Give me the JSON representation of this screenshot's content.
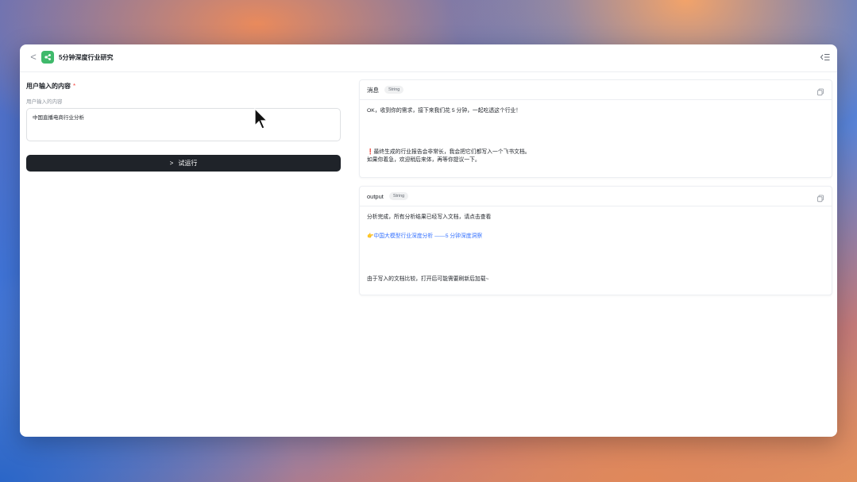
{
  "header": {
    "back_glyph": "<",
    "app_icon": "workflow-icon",
    "title": "5分钟深度行业研究",
    "collapse_icon": "collapse-panel-icon"
  },
  "form": {
    "label": "用户输入的内容",
    "required_mark": "*",
    "hint": "用户输入的内容",
    "input_value": "中国直播电商行业分析",
    "run_label": "试运行",
    "run_glyph": ">"
  },
  "cards": [
    {
      "title": "消息",
      "type": "String",
      "lines": [
        "OK，收到你的需求，接下来我们花 5 分钟，一起吃透这个行业！",
        "❗️最终生成的行业报告会非常长，我会把它们都写入一个飞书文档。",
        "如果你着急，欢迎稍后来体，再等你提议一下。"
      ]
    },
    {
      "title": "output",
      "type": "String",
      "lines": [
        "分析完成，所有分析结果已经写入文档，请点击查看",
        "👉中国大模型行业深度分析 ——5 分钟深度洞察",
        "由于写入的文档比较，打开后可能需要刷新后加载~"
      ]
    }
  ],
  "colors": {
    "accent_green": "#3fb96b",
    "button_dark": "#1f2329",
    "link_blue": "#3370ff"
  }
}
